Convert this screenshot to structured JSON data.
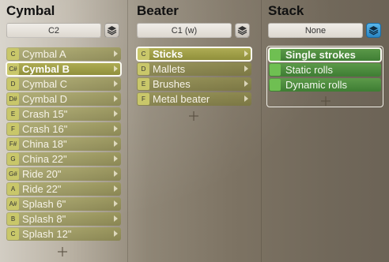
{
  "cymbal": {
    "title": "Cymbal",
    "selector_value": "C2",
    "items": [
      {
        "note": "C",
        "label": "Cymbal A"
      },
      {
        "note": "C#",
        "label": "Cymbal B"
      },
      {
        "note": "D",
        "label": "Cymbal C"
      },
      {
        "note": "D#",
        "label": "Cymbal D"
      },
      {
        "note": "E",
        "label": "Crash 15\""
      },
      {
        "note": "F",
        "label": "Crash 16\""
      },
      {
        "note": "F#",
        "label": "China 18\""
      },
      {
        "note": "G",
        "label": "China 22\""
      },
      {
        "note": "G#",
        "label": "Ride 20\""
      },
      {
        "note": "A",
        "label": "Ride 22\""
      },
      {
        "note": "A#",
        "label": "Splash 6\""
      },
      {
        "note": "B",
        "label": "Splash 8\""
      },
      {
        "note": "C",
        "label": "Splash 12\""
      }
    ],
    "selected_index": 1
  },
  "beater": {
    "title": "Beater",
    "selector_value": "C1 (w)",
    "items": [
      {
        "note": "C",
        "label": "Sticks"
      },
      {
        "note": "D",
        "label": "Mallets"
      },
      {
        "note": "E",
        "label": "Brushes"
      },
      {
        "note": "F",
        "label": "Metal beater"
      }
    ],
    "selected_index": 0
  },
  "stack": {
    "title": "Stack",
    "selector_value": "None",
    "items": [
      {
        "label": "Single strokes"
      },
      {
        "label": "Static rolls"
      },
      {
        "label": "Dynamic rolls"
      }
    ],
    "selected_index": 0
  },
  "colors": {
    "item_olive": "#8e8d3a",
    "item_green": "#3e7d33",
    "active_blue": "#2a86c4",
    "selection_outline": "#fbfaf2"
  },
  "icons": {
    "layers": "layers-icon",
    "add": "plus-icon",
    "expand": "chevron-right-icon"
  }
}
